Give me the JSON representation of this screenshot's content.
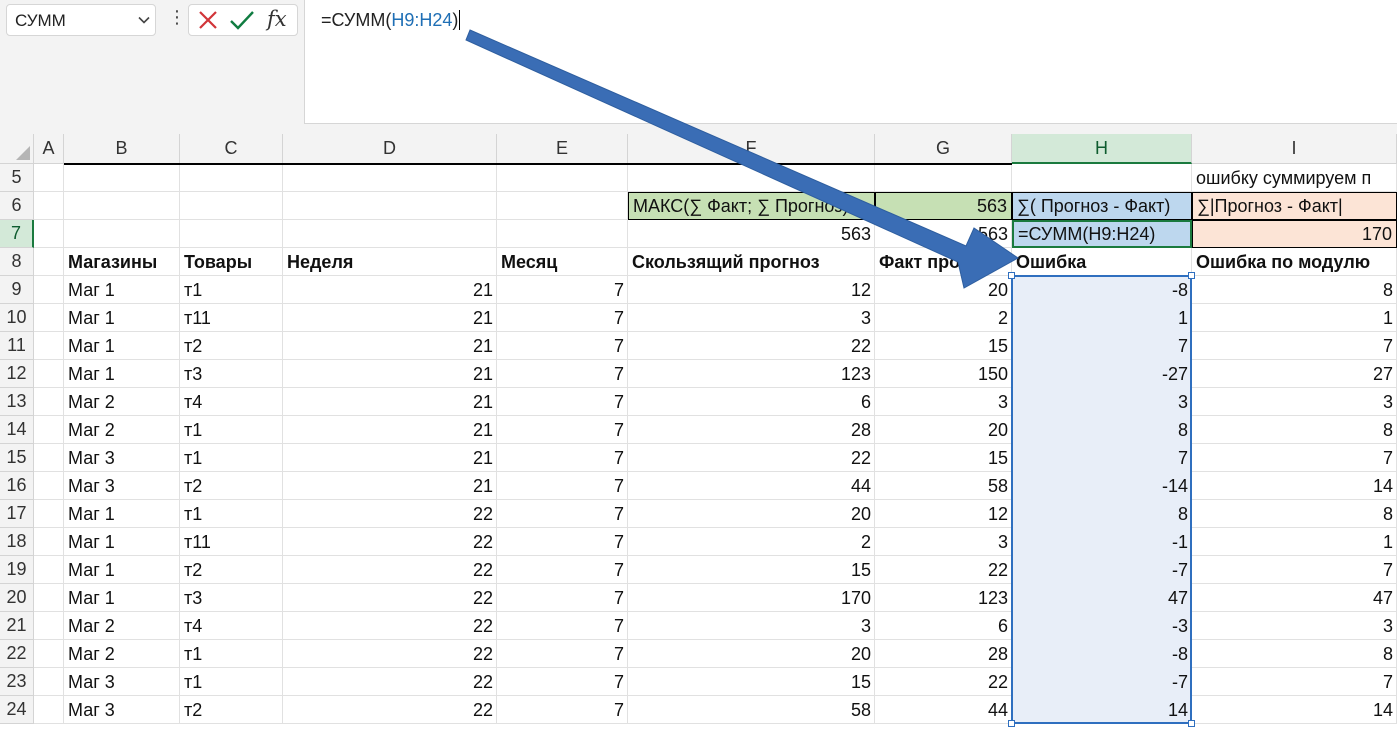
{
  "name_box": {
    "value": "СУММ"
  },
  "formula_bar": {
    "prefix": "=СУММ(",
    "reference": "H9:H24",
    "suffix": ")",
    "icons": [
      "cancel-x-icon",
      "enter-check-icon",
      "insert-function-fx-icon"
    ],
    "fx_label": "fx"
  },
  "colors": {
    "cancel": "#d13438",
    "enter": "#107c41",
    "reference": "#1f6fb5",
    "header_selected_bg": "#d3e9d8",
    "header_selected_text": "#0e5c2f",
    "green_fill": "#c6e0b4",
    "blue_fill": "#bdd7ee",
    "orange_fill": "#fce4d6",
    "selection_fill": "#e8eef8",
    "selection_border": "#2f6fbf",
    "arrow": "#3a6db5"
  },
  "columns": [
    "A",
    "B",
    "C",
    "D",
    "E",
    "F",
    "G",
    "H",
    "I"
  ],
  "selected_column": "H",
  "selected_row": "7",
  "rows": [
    "5",
    "6",
    "7",
    "8",
    "9",
    "10",
    "11",
    "12",
    "13",
    "14",
    "15",
    "16",
    "17",
    "18",
    "19",
    "20",
    "21",
    "22",
    "23",
    "24"
  ],
  "cells": {
    "I5": "ошибку суммируем п",
    "F6": "МАКС(∑ Факт; ∑ Прогноз)",
    "G6": "563",
    "H6": "∑( Прогноз - Факт)",
    "I6": "∑|Прогноз - Факт|",
    "F7": "563",
    "G7": "563",
    "H7": "=СУММ(H9:H24)",
    "I7": "170"
  },
  "table_headers": {
    "B": "Магазины",
    "C": "Товары",
    "D": "Неделя",
    "E": "Месяц",
    "F": "Скользящий прогноз",
    "G": "Факт продаж",
    "H": "Ошибка",
    "I": "Ошибка по модулю"
  },
  "data_rows": [
    [
      "Маг 1",
      "т1",
      "21",
      "7",
      "12",
      "20",
      "-8",
      "8"
    ],
    [
      "Маг 1",
      "т11",
      "21",
      "7",
      "3",
      "2",
      "1",
      "1"
    ],
    [
      "Маг 1",
      "т2",
      "21",
      "7",
      "22",
      "15",
      "7",
      "7"
    ],
    [
      "Маг 1",
      "т3",
      "21",
      "7",
      "123",
      "150",
      "-27",
      "27"
    ],
    [
      "Маг 2",
      "т4",
      "21",
      "7",
      "6",
      "3",
      "3",
      "3"
    ],
    [
      "Маг 2",
      "т1",
      "21",
      "7",
      "28",
      "20",
      "8",
      "8"
    ],
    [
      "Маг 3",
      "т1",
      "21",
      "7",
      "22",
      "15",
      "7",
      "7"
    ],
    [
      "Маг 3",
      "т2",
      "21",
      "7",
      "44",
      "58",
      "-14",
      "14"
    ],
    [
      "Маг 1",
      "т1",
      "22",
      "7",
      "20",
      "12",
      "8",
      "8"
    ],
    [
      "Маг 1",
      "т11",
      "22",
      "7",
      "2",
      "3",
      "-1",
      "1"
    ],
    [
      "Маг 1",
      "т2",
      "22",
      "7",
      "15",
      "22",
      "-7",
      "7"
    ],
    [
      "Маг 1",
      "т3",
      "22",
      "7",
      "170",
      "123",
      "47",
      "47"
    ],
    [
      "Маг 2",
      "т4",
      "22",
      "7",
      "3",
      "6",
      "-3",
      "3"
    ],
    [
      "Маг 2",
      "т1",
      "22",
      "7",
      "20",
      "28",
      "-8",
      "8"
    ],
    [
      "Маг 3",
      "т1",
      "22",
      "7",
      "15",
      "22",
      "-7",
      "7"
    ],
    [
      "Маг 3",
      "т2",
      "22",
      "7",
      "58",
      "44",
      "14",
      "14"
    ]
  ]
}
